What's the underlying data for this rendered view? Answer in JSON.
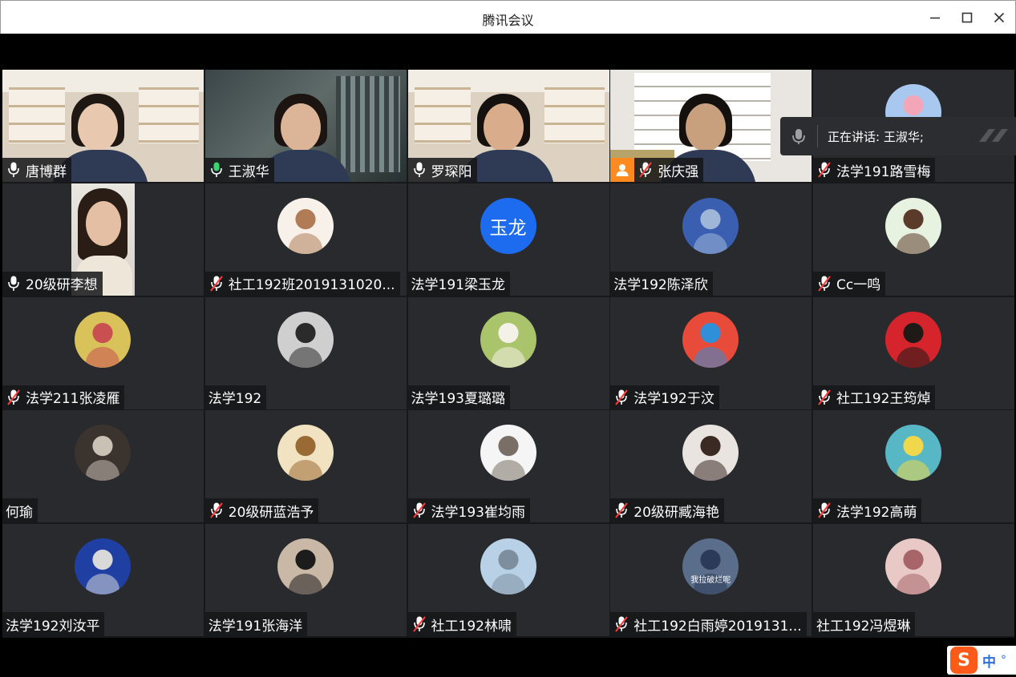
{
  "window": {
    "title": "腾讯会议"
  },
  "speaking": {
    "text": "正在讲话: 王淑华;"
  },
  "ime": {
    "logo": "S",
    "mode": "中",
    "punct": "°"
  },
  "tiles": [
    {
      "name": "唐博群",
      "mic": "on",
      "kind": "video",
      "scene": "shelf-room",
      "face": "#e8c8ae",
      "hair": "#1e1712"
    },
    {
      "name": "王淑华",
      "mic": "speaking",
      "kind": "video",
      "scene": "dark-room",
      "face": "#dcb598",
      "hair": "#1b1410",
      "active": true
    },
    {
      "name": "罗琛阳",
      "mic": "on",
      "kind": "video",
      "scene": "shelf-room",
      "face": "#d9ad8c",
      "hair": "#15110e"
    },
    {
      "name": "张庆强",
      "mic": "muted",
      "kind": "video",
      "scene": "white-shelf",
      "face": "#c9a07e",
      "hair": "#14100d",
      "badge": "person-icon"
    },
    {
      "name": "法学191路雪梅",
      "mic": "muted",
      "kind": "avatar",
      "colors": [
        "#a9c8f0",
        "#f2a6b8"
      ]
    },
    {
      "name": "20级研李想",
      "mic": "on",
      "kind": "video",
      "scene": "portrait",
      "face": "#e5bfa3",
      "hair": "#2a1d15"
    },
    {
      "name": "社工192班2019131020...",
      "mic": "muted",
      "kind": "avatar",
      "colors": [
        "#f7f1ea",
        "#b07b55"
      ]
    },
    {
      "name": "法学191梁玉龙",
      "mic": "none",
      "kind": "text-avatar",
      "avatar_text": "玉龙",
      "colors": [
        "#1d6cf0"
      ]
    },
    {
      "name": "法学192陈泽欣",
      "mic": "none",
      "kind": "avatar",
      "colors": [
        "#3a5fb0",
        "#9fb6d8"
      ]
    },
    {
      "name": "Cc一鸣",
      "mic": "muted",
      "kind": "avatar",
      "colors": [
        "#e8f2e0",
        "#5a3b2a"
      ]
    },
    {
      "name": "法学211张凌雁",
      "mic": "muted",
      "kind": "avatar",
      "colors": [
        "#d9c25a",
        "#c85050"
      ]
    },
    {
      "name": "法学192",
      "mic": "none",
      "kind": "avatar",
      "colors": [
        "#cfcfcf",
        "#2b2b2b"
      ]
    },
    {
      "name": "法学193夏璐璐",
      "mic": "none",
      "kind": "avatar",
      "colors": [
        "#a9c46a",
        "#f4f1e8"
      ]
    },
    {
      "name": "法学192于汶",
      "mic": "muted",
      "kind": "avatar",
      "colors": [
        "#e84b3a",
        "#2f8fd8"
      ]
    },
    {
      "name": "社工192王筠焯",
      "mic": "muted",
      "kind": "avatar",
      "colors": [
        "#d6242c",
        "#1f1a17"
      ]
    },
    {
      "name": "何瑜",
      "mic": "none",
      "kind": "avatar",
      "colors": [
        "#3a332e",
        "#c9c0b6"
      ]
    },
    {
      "name": "20级研蓝浩予",
      "mic": "muted",
      "kind": "avatar",
      "colors": [
        "#f1e3c2",
        "#9a6a35"
      ]
    },
    {
      "name": "法学193崔均雨",
      "mic": "muted",
      "kind": "avatar",
      "colors": [
        "#f5f5f5",
        "#7a6f66"
      ]
    },
    {
      "name": "20级研臧海艳",
      "mic": "muted",
      "kind": "avatar",
      "colors": [
        "#e9e4df",
        "#3b2a24"
      ]
    },
    {
      "name": "法学192高萌",
      "mic": "muted",
      "kind": "avatar",
      "colors": [
        "#57b7c4",
        "#f0d84a"
      ]
    },
    {
      "name": "法学192刘汝平",
      "mic": "none",
      "kind": "avatar",
      "colors": [
        "#1f3fa3",
        "#d9d9d9"
      ]
    },
    {
      "name": "法学191张海洋",
      "mic": "none",
      "kind": "avatar",
      "colors": [
        "#c9b8a6",
        "#1c1c1c"
      ]
    },
    {
      "name": "社工192林啸",
      "mic": "muted",
      "kind": "avatar",
      "colors": [
        "#b9d1e6",
        "#7d8f9e"
      ]
    },
    {
      "name": "社工192白雨婷2019131...",
      "mic": "muted",
      "kind": "avatar",
      "colors": [
        "#5a6d8a",
        "#2b3a58"
      ],
      "avatar_caption": "我拉破烂呢"
    },
    {
      "name": "社工192冯煜琳",
      "mic": "none",
      "kind": "avatar",
      "colors": [
        "#e8c9c6",
        "#a7656a"
      ]
    }
  ]
}
